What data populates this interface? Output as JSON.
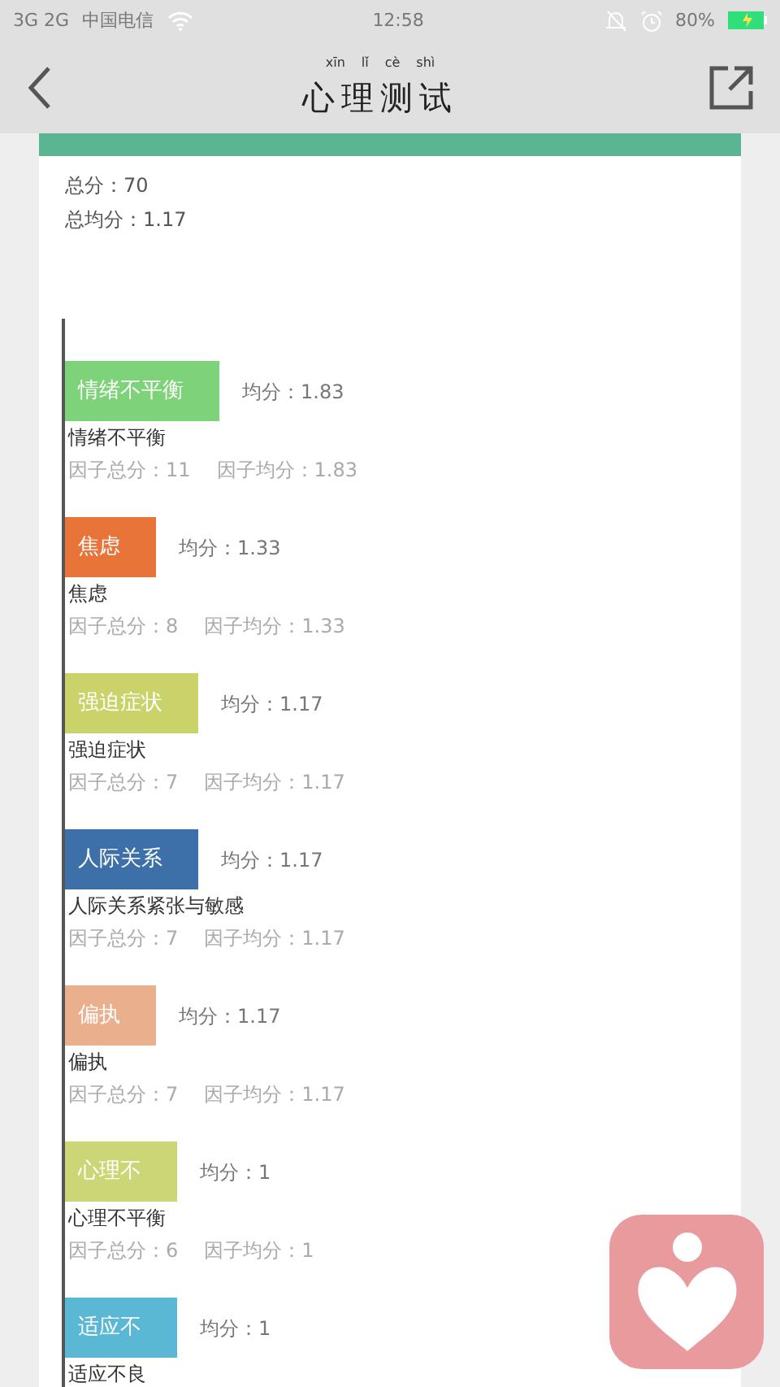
{
  "status_bar": {
    "network": "3G 2G",
    "carrier": "中国电信",
    "time": "12:58",
    "battery": "80%"
  },
  "header": {
    "title": "心理测试",
    "title_pinyin": [
      "xīn",
      "lǐ",
      "cè",
      "shì"
    ]
  },
  "summary": [
    {
      "label": "总分：",
      "value": "70"
    },
    {
      "label": "总均分：",
      "value": "1.17"
    }
  ],
  "factors": [
    {
      "bar_label": "情绪不平衡",
      "color": "#7ed37a",
      "average": "均分：1.83",
      "name": "情绪不平衡",
      "total": "因子总分：11",
      "factor_average": "因子均分：1.83"
    },
    {
      "bar_label": "焦虑",
      "color": "#e8743a",
      "average": "均分：1.33",
      "name": "焦虑",
      "total": "因子总分：8",
      "factor_average": "因子均分：1.33"
    },
    {
      "bar_label": "强迫症状",
      "color": "#c9d36a",
      "average": "均分：1.17",
      "name": "强迫症状",
      "total": "因子总分：7",
      "factor_average": "因子均分：1.17"
    },
    {
      "bar_label": "人际关系",
      "color": "#3d6fa8",
      "average": "均分：1.17",
      "name": "人际关系紧张与敏感",
      "total": "因子总分：7",
      "factor_average": "因子均分：1.17"
    },
    {
      "bar_label": "偏执",
      "color": "#eab08e",
      "average": "均分：1.17",
      "name": "偏执",
      "total": "因子总分：7",
      "factor_average": "因子均分：1.17"
    },
    {
      "bar_label": "心理不",
      "color": "#cdd676",
      "average": "均分：1",
      "name": "心理不平衡",
      "total": "因子总分：6",
      "factor_average": "因子均分：1"
    },
    {
      "bar_label": "适应不",
      "color": "#5ab8d4",
      "average": "均分：1",
      "name": "适应不良"
    }
  ]
}
